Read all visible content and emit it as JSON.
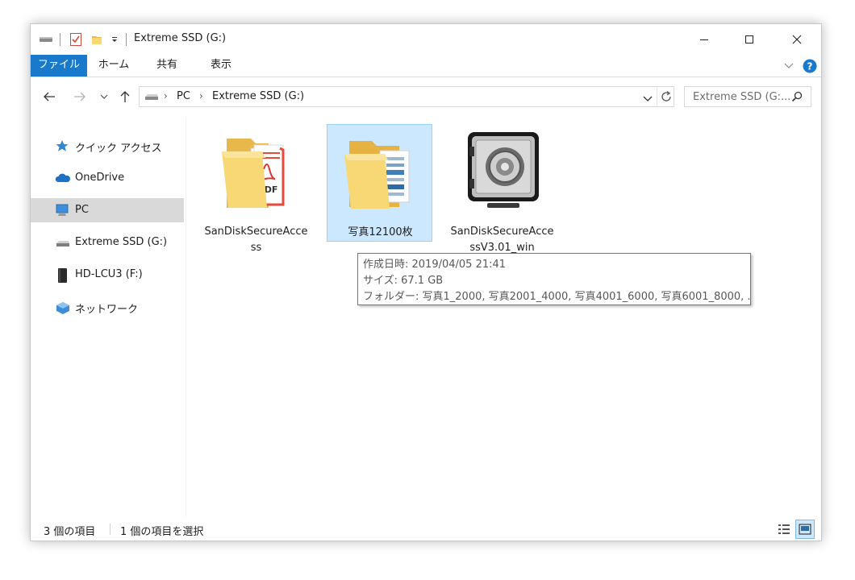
{
  "window": {
    "title": "Extreme SSD (G:)"
  },
  "ribbon": {
    "tabs": [
      {
        "label": "ファイル",
        "active": true
      },
      {
        "label": "ホーム",
        "active": false
      },
      {
        "label": "共有",
        "active": false
      },
      {
        "label": "表示",
        "active": false
      }
    ]
  },
  "address": {
    "segments": [
      "PC",
      "Extreme SSD (G:)"
    ]
  },
  "search": {
    "placeholder": "Extreme SSD (G:..."
  },
  "nav": {
    "items": [
      {
        "label": "クイック アクセス",
        "icon": "star-icon"
      },
      {
        "label": "OneDrive",
        "icon": "cloud-icon"
      },
      {
        "label": "PC",
        "icon": "pc-icon",
        "selected": true
      },
      {
        "label": "Extreme SSD (G:)",
        "icon": "drive-icon"
      },
      {
        "label": "HD-LCU3 (F:)",
        "icon": "external-drive-icon"
      },
      {
        "label": "ネットワーク",
        "icon": "network-icon"
      }
    ]
  },
  "files": [
    {
      "name": "SanDiskSecureAccess",
      "icon": "pdf-folder-icon"
    },
    {
      "name": "写真12100枚",
      "icon": "folder-icon",
      "selected": true
    },
    {
      "name": "SanDiskSecureAccessV3.01_win",
      "icon": "vault-icon"
    }
  ],
  "tooltip": {
    "created": "作成日時: 2019/04/05 21:41",
    "size": "サイズ: 67.1 GB",
    "folders": "フォルダー: 写真1_2000, 写真2001_4000, 写真4001_6000, 写真6001_8000, ..."
  },
  "status": {
    "item_count": "3 個の項目",
    "selected_count": "1 個の項目を選択"
  },
  "colors": {
    "accent": "#1979ca",
    "selection": "#cce8ff",
    "folder": "#f8d775"
  }
}
